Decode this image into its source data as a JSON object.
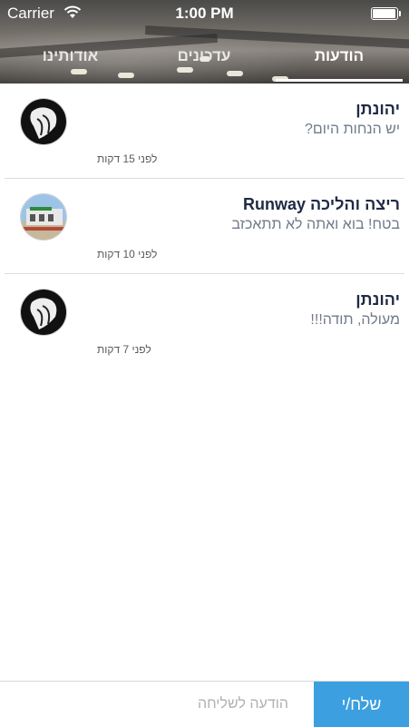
{
  "status_bar": {
    "carrier": "Carrier",
    "time": "1:00 PM",
    "battery_level": 0.95
  },
  "tabs": [
    {
      "label": "הודעות",
      "active": true
    },
    {
      "label": "עדכונים",
      "active": false
    },
    {
      "label": "אודותינו",
      "active": false
    }
  ],
  "messages": [
    {
      "sender": "יהונתן",
      "text": "יש הנחות היום?",
      "time": "לפני 15 דקות",
      "avatar": "dark-avatar"
    },
    {
      "sender": "ריצה והליכה Runway",
      "text": "בטח! בוא ואתה לא תתאכזב",
      "time": "לפני 10 דקות",
      "avatar": "store-avatar"
    },
    {
      "sender": "יהונתן",
      "text": "מעולה, תודה!!!",
      "time": "לפני 7 דקות",
      "avatar": "dark-avatar"
    }
  ],
  "composer": {
    "placeholder": "הודעה לשליחה",
    "send_label": "שלח/י"
  },
  "colors": {
    "accent": "#3b9fe0",
    "sender_text": "#1f2a44",
    "message_text": "#707b8a"
  }
}
